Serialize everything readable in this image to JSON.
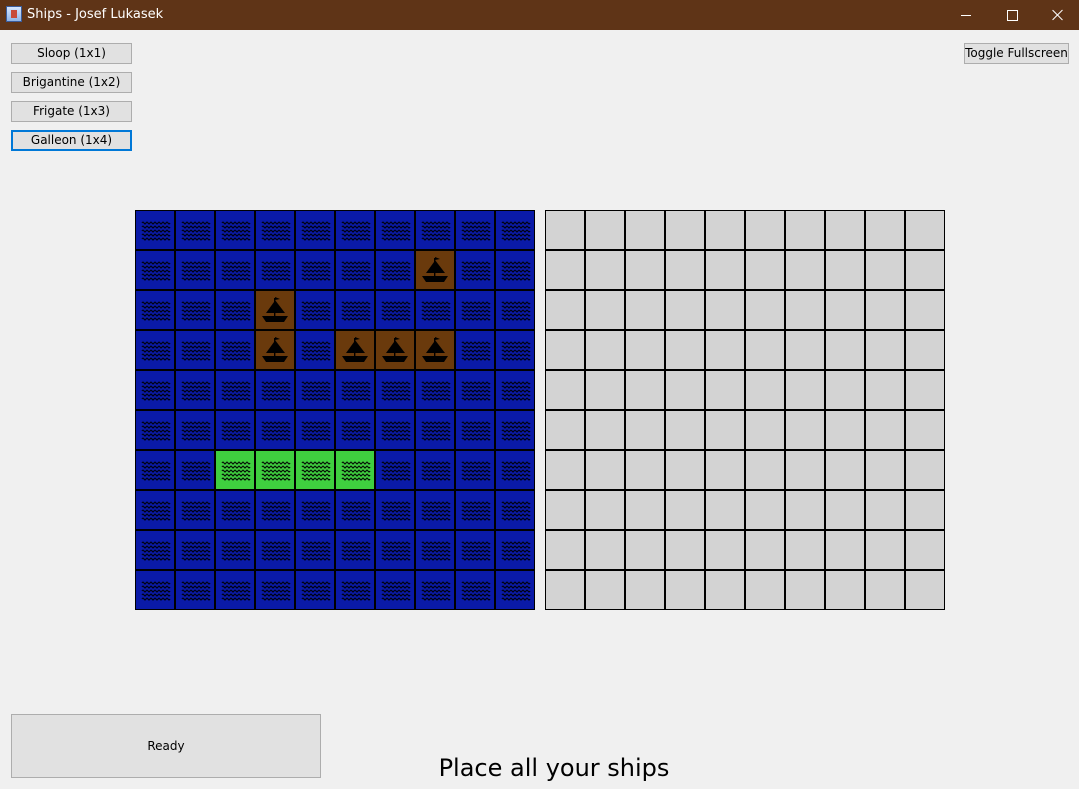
{
  "window": {
    "title": "Ships - Josef Lukasek",
    "controls": [
      "minimize-icon",
      "maximize-icon",
      "close-icon"
    ]
  },
  "ship_buttons": [
    {
      "label": "Sloop (1x1)",
      "selected": false
    },
    {
      "label": "Brigantine (1x2)",
      "selected": false
    },
    {
      "label": "Frigate (1x3)",
      "selected": false
    },
    {
      "label": "Galleon (1x4)",
      "selected": true
    }
  ],
  "toggle_fullscreen_label": "Toggle Fullscreen",
  "ready_label": "Ready",
  "status_message": "Place all your ships",
  "colors": {
    "water": "#0a1aa8",
    "ship": "#6a3a0c",
    "placement_preview": "#3fcf3f",
    "unknown": "#d3d3d3",
    "titlebar": "#5f3417",
    "selected_border": "#0078d7"
  },
  "player_board": {
    "rows": [
      "WWWWWWWWWW",
      "WWWWWWWSWW",
      "WWWSWWWWWW",
      "WWWSWSSSWW",
      "WWWWWWWWWW",
      "WWWWWWWWWW",
      "WWPPPPWWWW",
      "WWWWWWWWWW",
      "WWWWWWWWWW",
      "WWWWWWWWWW"
    ],
    "legend": {
      "W": "water-icon",
      "S": "ship-icon",
      "P": "placement-preview"
    }
  },
  "enemy_board": {
    "rows": [
      "UUUUUUUUUU",
      "UUUUUUUUUU",
      "UUUUUUUUUU",
      "UUUUUUUUUU",
      "UUUUUUUUUU",
      "UUUUUUUUUU",
      "UUUUUUUUUU",
      "UUUUUUUUUU",
      "UUUUUUUUUU",
      "UUUUUUUUUU"
    ],
    "legend": {
      "U": "unknown"
    }
  }
}
